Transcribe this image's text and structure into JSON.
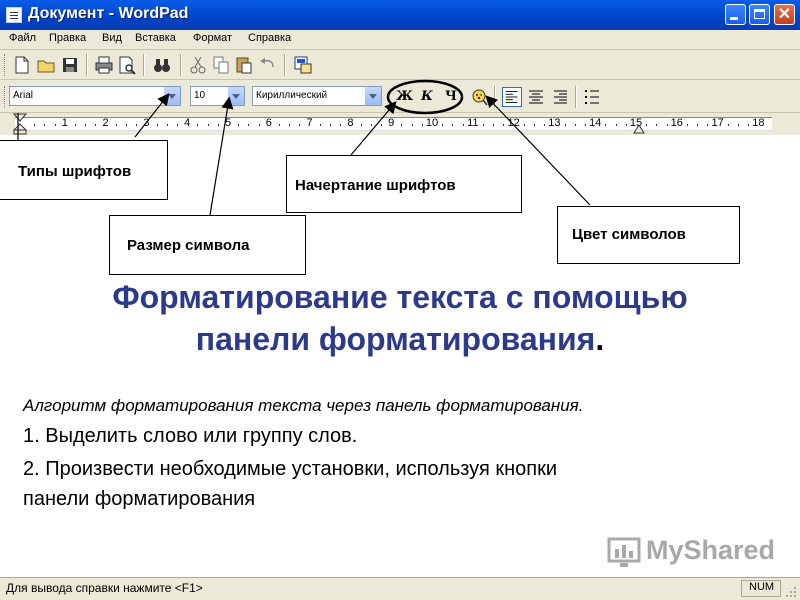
{
  "window": {
    "title": "Документ - WordPad"
  },
  "menu": [
    "Файл",
    "Правка",
    "Вид",
    "Вставка",
    "Формат",
    "Справка"
  ],
  "format_bar": {
    "font_name": "Arial",
    "font_size": "10",
    "script": "Кириллический",
    "bold": "Ж",
    "italic": "К",
    "underline": "Ч"
  },
  "ruler_numbers": [
    "1",
    "2",
    "3",
    "4",
    "5",
    "6",
    "7",
    "8",
    "9",
    "10",
    "11",
    "12",
    "13",
    "14",
    "15",
    "16",
    "17",
    "18"
  ],
  "annotations": {
    "font_types": "Типы шрифтов",
    "char_size": "Размер символа",
    "font_style": "Начертание шрифтов",
    "char_color": "Цвет символов"
  },
  "content": {
    "heading_line1": "Форматирование текста с помощью",
    "heading_line2": "панели форматирования",
    "heading_period": ".",
    "intro": "Алгоритм форматирования текста через панель форматирования.",
    "step1": "1. Выделить слово или группу слов.",
    "step2_line1": "2. Произвести необходимые установки, используя кнопки",
    "step2_line2": "панели форматирования"
  },
  "status": {
    "help": "Для вывода справки нажмите <F1>",
    "num": "NUM"
  },
  "watermark": {
    "text": "MyShared"
  },
  "colors": {
    "heading": "#2d3a8c",
    "title_bar": "#0043c8",
    "chrome": "#ece9d8"
  }
}
